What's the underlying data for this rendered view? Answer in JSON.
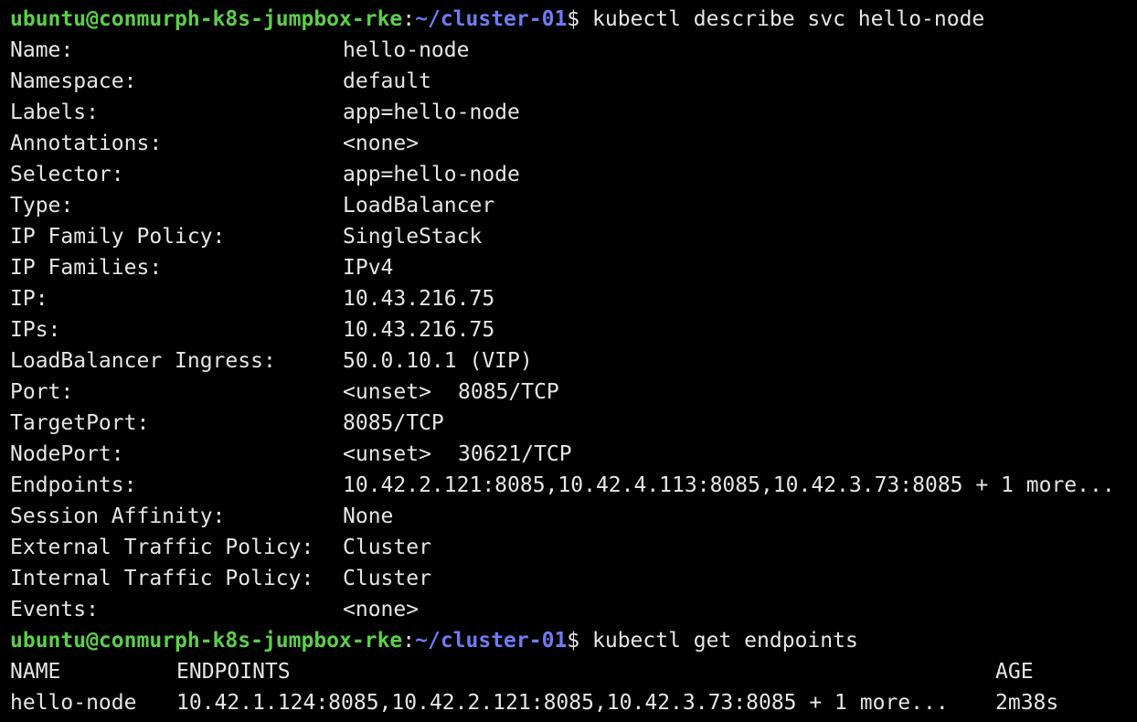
{
  "prompt": {
    "user_host": "ubuntu@conmurph-k8s-jumpbox-rke",
    "colon": ":",
    "path": "~/cluster-01",
    "dollar": "$"
  },
  "commands": {
    "describe": "kubectl describe svc hello-node",
    "get_endpoints": "kubectl get endpoints"
  },
  "describe": {
    "rows": [
      {
        "key": "Name:",
        "value": "hello-node"
      },
      {
        "key": "Namespace:",
        "value": "default"
      },
      {
        "key": "Labels:",
        "value": "app=hello-node"
      },
      {
        "key": "Annotations:",
        "value": "<none>"
      },
      {
        "key": "Selector:",
        "value": "app=hello-node"
      },
      {
        "key": "Type:",
        "value": "LoadBalancer"
      },
      {
        "key": "IP Family Policy:",
        "value": "SingleStack"
      },
      {
        "key": "IP Families:",
        "value": "IPv4"
      },
      {
        "key": "IP:",
        "value": "10.43.216.75"
      },
      {
        "key": "IPs:",
        "value": "10.43.216.75"
      },
      {
        "key": "LoadBalancer Ingress:",
        "value": "50.0.10.1 (VIP)"
      },
      {
        "key": "Port:",
        "value_a": "<unset>",
        "value_b": "8085/TCP"
      },
      {
        "key": "TargetPort:",
        "value": "8085/TCP"
      },
      {
        "key": "NodePort:",
        "value_a": "<unset>",
        "value_b": "30621/TCP"
      },
      {
        "key": "Endpoints:",
        "value": "10.42.2.121:8085,10.42.4.113:8085,10.42.3.73:8085 + 1 more..."
      },
      {
        "key": "Session Affinity:",
        "value": "None"
      },
      {
        "key": "External Traffic Policy:",
        "value": "Cluster"
      },
      {
        "key": "Internal Traffic Policy:",
        "value": "Cluster"
      },
      {
        "key": "Events:",
        "value": "<none>"
      }
    ]
  },
  "endpoints_table": {
    "headers": {
      "name": "NAME",
      "endpoints": "ENDPOINTS",
      "age": "AGE"
    },
    "rows": [
      {
        "name": "hello-node",
        "endpoints": "10.42.1.124:8085,10.42.2.121:8085,10.42.3.73:8085 + 1 more...",
        "age": "2m38s"
      }
    ]
  },
  "colors": {
    "background": "#000000",
    "foreground": "#e6e6e6",
    "prompt_user": "#5ccf4a",
    "prompt_path": "#6f7cf0"
  }
}
